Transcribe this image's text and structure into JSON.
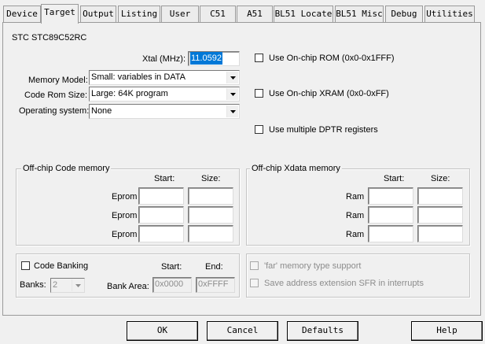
{
  "tabs": [
    {
      "label": "Device"
    },
    {
      "label": "Target"
    },
    {
      "label": "Output"
    },
    {
      "label": "Listing"
    },
    {
      "label": "User"
    },
    {
      "label": "C51"
    },
    {
      "label": "A51"
    },
    {
      "label": "BL51 Locate"
    },
    {
      "label": "BL51 Misc"
    },
    {
      "label": "Debug"
    },
    {
      "label": "Utilities"
    }
  ],
  "active_tab": "Target",
  "device_name": "STC STC89C52RC",
  "xtal": {
    "label": "Xtal (MHz):",
    "value": "11.0592"
  },
  "memory_model": {
    "label": "Memory Model:",
    "value": "Small: variables in DATA"
  },
  "code_rom_size": {
    "label": "Code Rom Size:",
    "value": "Large: 64K program"
  },
  "operating_system": {
    "label": "Operating system:",
    "value": "None"
  },
  "checkboxes": {
    "onchip_rom": {
      "label": "Use On-chip ROM (0x0-0x1FFF)",
      "checked": false
    },
    "onchip_xram": {
      "label": "Use On-chip XRAM (0x0-0xFF)",
      "checked": false
    },
    "multiple_dptr": {
      "label": "Use multiple DPTR registers",
      "checked": false
    }
  },
  "code_memory": {
    "title": "Off-chip Code memory",
    "start_header": "Start:",
    "size_header": "Size:",
    "rows": [
      {
        "label": "Eprom",
        "start": "",
        "size": ""
      },
      {
        "label": "Eprom",
        "start": "",
        "size": ""
      },
      {
        "label": "Eprom",
        "start": "",
        "size": ""
      }
    ]
  },
  "xdata_memory": {
    "title": "Off-chip Xdata memory",
    "start_header": "Start:",
    "size_header": "Size:",
    "rows": [
      {
        "label": "Ram",
        "start": "",
        "size": ""
      },
      {
        "label": "Ram",
        "start": "",
        "size": ""
      },
      {
        "label": "Ram",
        "start": "",
        "size": ""
      }
    ]
  },
  "code_banking": {
    "label": "Code Banking",
    "checked": false,
    "start_header": "Start:",
    "end_header": "End:",
    "banks_label": "Banks:",
    "banks_value": "2",
    "bank_area_label": "Bank Area:",
    "bank_area_start": "0x0000",
    "bank_area_end": "0xFFFF"
  },
  "far_options": {
    "far_memory": {
      "label": "'far' memory type support",
      "checked": false,
      "disabled": true
    },
    "save_sfr": {
      "label": "Save address extension SFR in interrupts",
      "checked": false,
      "disabled": true
    }
  },
  "buttons": {
    "ok": "OK",
    "cancel": "Cancel",
    "defaults": "Defaults",
    "help": "Help"
  }
}
